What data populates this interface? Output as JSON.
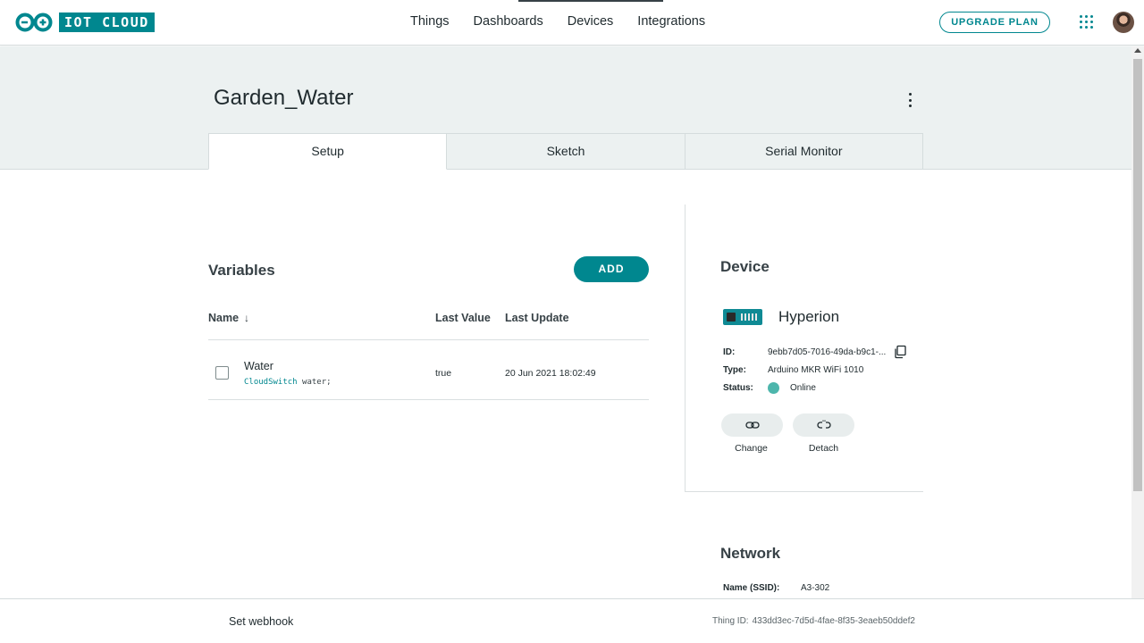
{
  "brand": {
    "logo_text": "IOT CLOUD"
  },
  "nav": {
    "links": [
      "Things",
      "Dashboards",
      "Devices",
      "Integrations"
    ],
    "upgrade_label": "UPGRADE PLAN"
  },
  "thing": {
    "title": "Garden_Water",
    "tabs": [
      "Setup",
      "Sketch",
      "Serial Monitor"
    ],
    "active_tab": "Setup"
  },
  "variables": {
    "title": "Variables",
    "add_label": "ADD",
    "columns": {
      "name": "Name",
      "last_value": "Last Value",
      "last_update": "Last Update"
    },
    "rows": [
      {
        "name": "Water",
        "decl_type": "CloudSwitch",
        "decl_var": "water;",
        "last_value": "true",
        "last_update": "20 Jun 2021 18:02:49"
      }
    ]
  },
  "device": {
    "title": "Device",
    "name": "Hyperion",
    "id_label": "ID:",
    "id_value": "9ebb7d05-7016-49da-b9c1-...",
    "type_label": "Type:",
    "type_value": "Arduino MKR WiFi 1010",
    "status_label": "Status:",
    "status_value": "Online",
    "status_color": "#4db6ac",
    "change_label": "Change",
    "detach_label": "Detach"
  },
  "network": {
    "title": "Network",
    "ssid_label": "Name (SSID):",
    "ssid_value": "A3-302"
  },
  "footer": {
    "webhook_label": "Set webhook",
    "thing_id_label": "Thing ID:",
    "thing_id_value": "433dd3ec-7d5d-4fae-8f35-3eaeb50ddef2"
  },
  "colors": {
    "accent": "#00878f",
    "header_bg": "#ecf1f1"
  }
}
